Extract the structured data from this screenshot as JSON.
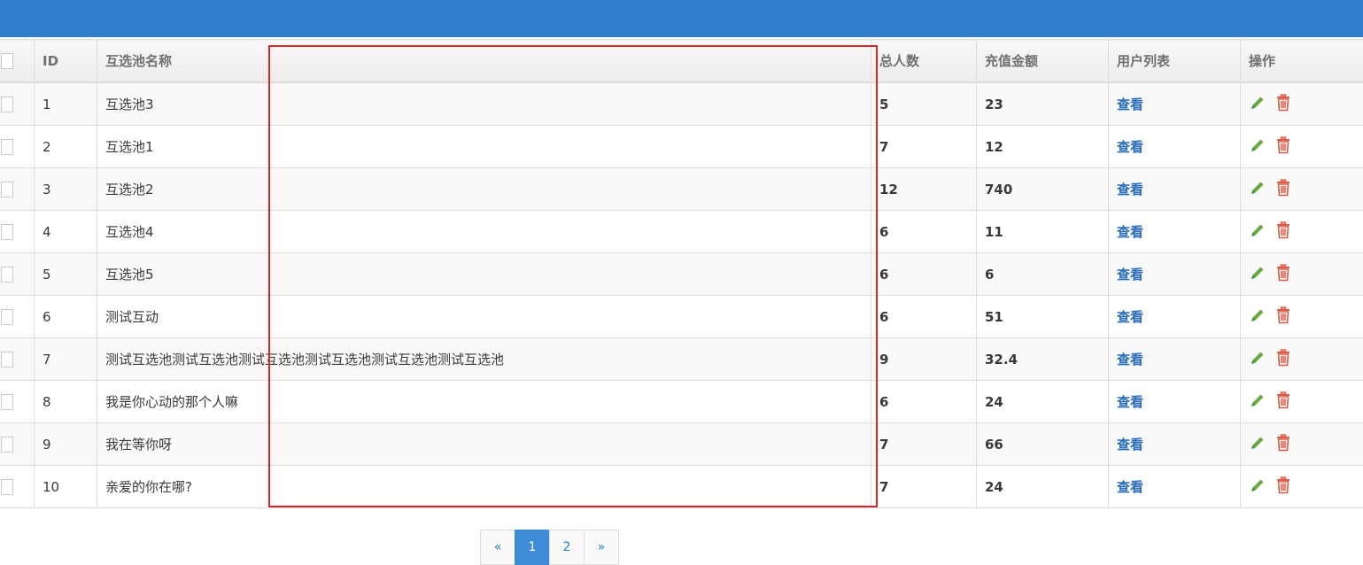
{
  "table": {
    "headers": {
      "id": "ID",
      "name": "互选池名称",
      "total": "总人数",
      "amount": "充值金额",
      "users": "用户列表",
      "ops": "操作"
    },
    "view_label": "查看",
    "rows": [
      {
        "id": "1",
        "name": "互选池3",
        "total": "5",
        "amount": "23"
      },
      {
        "id": "2",
        "name": "互选池1",
        "total": "7",
        "amount": "12"
      },
      {
        "id": "3",
        "name": "互选池2",
        "total": "12",
        "amount": "740"
      },
      {
        "id": "4",
        "name": "互选池4",
        "total": "6",
        "amount": "11"
      },
      {
        "id": "5",
        "name": "互选池5",
        "total": "6",
        "amount": "6"
      },
      {
        "id": "6",
        "name": "测试互动",
        "total": "6",
        "amount": "51"
      },
      {
        "id": "7",
        "name": "测试互选池测试互选池测试互选池测试互选池测试互选池测试互选池",
        "total": "9",
        "amount": "32.4"
      },
      {
        "id": "8",
        "name": "我是你心动的那个人嘛",
        "total": "6",
        "amount": "24"
      },
      {
        "id": "9",
        "name": "我在等你呀",
        "total": "7",
        "amount": "66"
      },
      {
        "id": "10",
        "name": "亲爱的你在哪?",
        "total": "7",
        "amount": "24"
      }
    ]
  },
  "pagination": {
    "prev": "«",
    "pages": [
      "1",
      "2"
    ],
    "next": "»",
    "current": "1"
  },
  "colors": {
    "topbar": "#307ecc",
    "highlight": "#d9242b",
    "edit": "#69aa46",
    "delete": "#dd5a43",
    "link": "#2a6ebb"
  }
}
